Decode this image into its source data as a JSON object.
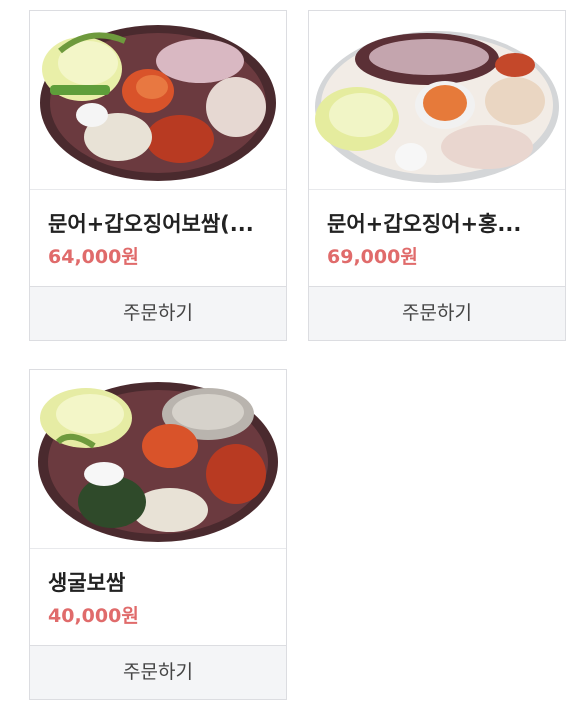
{
  "products": [
    {
      "title": "문어+갑오징어보쌈(...",
      "price": "64,000원",
      "order_label": "주문하기",
      "image_icon": "bossam-platter-image"
    },
    {
      "title": "문어+갑오징어+홍...",
      "price": "69,000원",
      "order_label": "주문하기",
      "image_icon": "bossam-platter-image"
    },
    {
      "title": "생굴보쌈",
      "price": "40,000원",
      "order_label": "주문하기",
      "image_icon": "oyster-bossam-platter-image"
    }
  ],
  "colors": {
    "price": "#e06b6b",
    "order_button_bg": "#f4f5f7",
    "border": "#dcdde1"
  }
}
